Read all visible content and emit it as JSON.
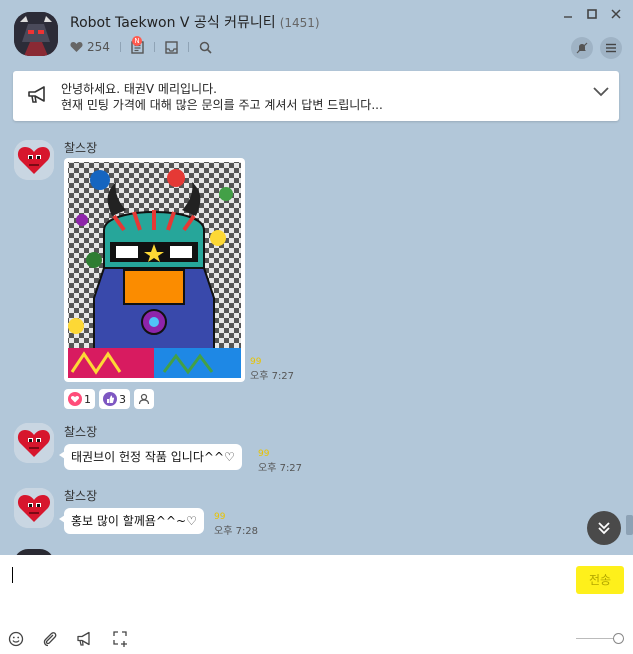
{
  "header": {
    "title": "Robot Taekwon V 공식 커뮤니티",
    "member_count": "(1451)",
    "likes": "254",
    "new_badge": "N"
  },
  "notice": {
    "line1": "안녕하세요. 태권V 메리입니다.",
    "line2": "현재 민팅 가격에 대해 많은 문의를 주고 계셔서 답변 드립니다..."
  },
  "messages": [
    {
      "sender": "찰스장",
      "type": "image",
      "read_mark": "99",
      "time": "오후 7:27",
      "reactions": {
        "heart": "1",
        "thumb": "3"
      }
    },
    {
      "sender": "찰스장",
      "type": "text",
      "text": "태권브이 헌정 작품 입니다^^♡",
      "read_mark": "99",
      "time": "오후 7:27"
    },
    {
      "sender": "찰스장",
      "type": "text",
      "text": "홍보 많이 할께욤^^~♡",
      "read_mark": "99",
      "time": "오후 7:28"
    }
  ],
  "input": {
    "send_label": "전송"
  },
  "colors": {
    "background": "#b2c7d9",
    "send_button": "#fef01b",
    "bubble": "#ffffff"
  },
  "icons": [
    "heart-icon",
    "notice-board-icon",
    "inbox-icon",
    "search-icon",
    "mute-icon",
    "menu-icon",
    "megaphone-icon",
    "chevron-down-icon",
    "emoji-icon",
    "attach-icon",
    "announce-icon",
    "capture-icon",
    "scroll-down-icon"
  ]
}
